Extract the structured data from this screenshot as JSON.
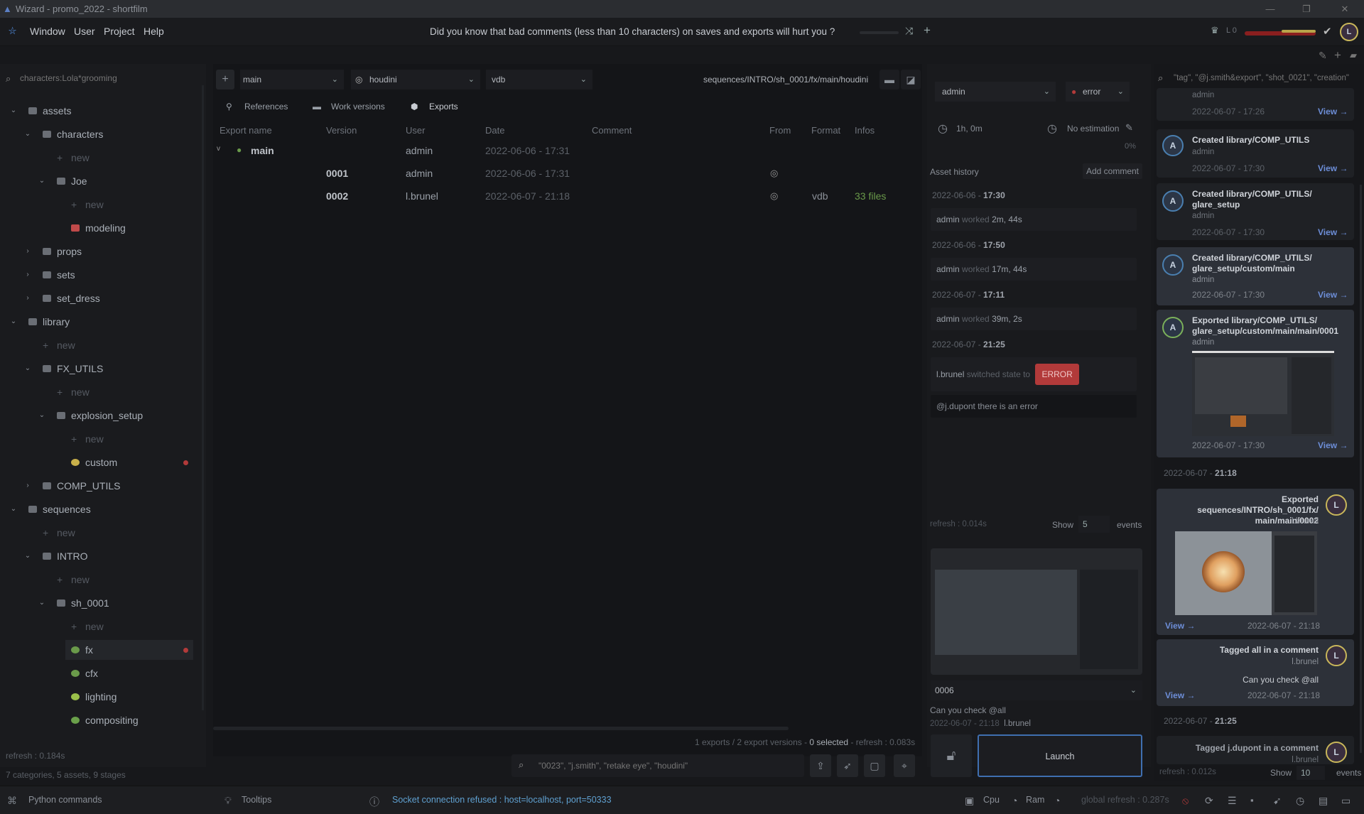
{
  "window": {
    "title": "Wizard - promo_2022 - shortfilm"
  },
  "menu": {
    "items": [
      "Window",
      "User",
      "Project",
      "Help"
    ]
  },
  "tip": "Did you know that bad comments (less than 10 characters) on saves and exports will hurt you ?",
  "header_right": {
    "level": "L 0",
    "avatar": "L"
  },
  "left": {
    "search_placeholder": "characters:Lola*grooming",
    "tree": [
      {
        "label": "assets",
        "depth": 0,
        "chev": "v"
      },
      {
        "label": "characters",
        "depth": 1,
        "chev": "v"
      },
      {
        "label": "new",
        "depth": 2,
        "new": true
      },
      {
        "label": "Joe",
        "depth": 2,
        "chev": "v"
      },
      {
        "label": "new",
        "depth": 3,
        "new": true
      },
      {
        "label": "modeling",
        "depth": 3
      },
      {
        "label": "props",
        "depth": 1,
        "chev": ">"
      },
      {
        "label": "sets",
        "depth": 1,
        "chev": ">"
      },
      {
        "label": "set_dress",
        "depth": 1,
        "chev": ">"
      },
      {
        "label": "library",
        "depth": 0,
        "chev": "v"
      },
      {
        "label": "new",
        "depth": 1,
        "new": true
      },
      {
        "label": "FX_UTILS",
        "depth": 1,
        "chev": "v"
      },
      {
        "label": "new",
        "depth": 2,
        "new": true
      },
      {
        "label": "explosion_setup",
        "depth": 2,
        "chev": "v"
      },
      {
        "label": "new",
        "depth": 3,
        "new": true
      },
      {
        "label": "custom",
        "depth": 3,
        "dot": true
      },
      {
        "label": "COMP_UTILS",
        "depth": 1,
        "chev": ">"
      },
      {
        "label": "sequences",
        "depth": 0,
        "chev": "v"
      },
      {
        "label": "new",
        "depth": 1,
        "new": true
      },
      {
        "label": "INTRO",
        "depth": 1,
        "chev": "v"
      },
      {
        "label": "new",
        "depth": 2,
        "new": true
      },
      {
        "label": "sh_0001",
        "depth": 2,
        "chev": "v"
      },
      {
        "label": "new",
        "depth": 3,
        "new": true
      },
      {
        "label": "fx",
        "depth": 3,
        "dot": true,
        "selected": true
      },
      {
        "label": "cfx",
        "depth": 3
      },
      {
        "label": "lighting",
        "depth": 3
      },
      {
        "label": "compositing",
        "depth": 3
      }
    ],
    "refresh": "refresh : 0.184s",
    "summary": "7 categories, 5 assets, 9 stages"
  },
  "center": {
    "combo_main": "main",
    "combo_software": "houdini",
    "combo_format": "vdb",
    "path": "sequences/INTRO/sh_0001/fx/main/houdini",
    "tabs": [
      "References",
      "Work versions",
      "Exports"
    ],
    "columns": [
      "Export name",
      "Version",
      "User",
      "Date",
      "Comment",
      "From",
      "Format",
      "Infos"
    ],
    "group": {
      "name": "main",
      "user": "admin",
      "date": "2022-06-06 - 17:31"
    },
    "rows": [
      {
        "version": "0001",
        "user": "admin",
        "date": "2022-06-06 - 17:31",
        "format": "",
        "infos": ""
      },
      {
        "version": "0002",
        "user": "l.brunel",
        "date": "2022-06-07 - 21:18",
        "format": "vdb",
        "infos": "33 files"
      }
    ],
    "status_prefix": "1 exports / 2 export versions - ",
    "status_selected": "0 selected",
    "status_refresh": " - refresh : 0.083s",
    "search_placeholder": "\"0023\", \"j.smith\", \"retake eye\", \"houdini\""
  },
  "right": {
    "user_combo": "admin",
    "state_combo": "error",
    "time": "1h, 0m",
    "estimation": "No estimation",
    "percent": "0%",
    "history_title": "Asset history",
    "add_comment": "Add comment",
    "history": [
      {
        "date": "2022-06-06 - ",
        "time": "17:30",
        "user": "admin",
        "verb": "worked",
        "value": "2m, 44s"
      },
      {
        "date": "2022-06-06 - ",
        "time": "17:50",
        "user": "admin",
        "verb": "worked",
        "value": "17m, 44s"
      },
      {
        "date": "2022-06-07 - ",
        "time": "17:11",
        "user": "admin",
        "verb": "worked",
        "value": "39m, 2s"
      },
      {
        "date": "2022-06-07 - ",
        "time": "21:25",
        "user": "l.brunel",
        "verb": "switched state to",
        "value": "ERROR"
      }
    ],
    "comment": "@j.dupont there is an error",
    "refresh": "refresh : 0.014s",
    "show_label": "Show",
    "show_value": "5",
    "events_label": "events",
    "version_combo": "0006",
    "version_comment": "Can you check @all",
    "version_date": "2022-06-07 - 21:18",
    "version_user": "l.brunel",
    "launch": "Launch"
  },
  "feed": {
    "search_placeholder": "\"tag\", \"@j.smith&export\", \"shot_0021\", \"creation\"",
    "top_partial": {
      "user": "admin",
      "date": "2022-06-07 - 17:26",
      "view": "View →"
    },
    "cards": [
      {
        "title": "Created library/COMP_UTILS",
        "user": "admin",
        "date": "2022-06-07 - 17:30",
        "view": "View →",
        "avatar": "A"
      },
      {
        "title": "Created library/COMP_UTILS/ glare_setup",
        "user": "admin",
        "date": "2022-06-07 - 17:30",
        "view": "View →",
        "avatar": "A"
      },
      {
        "title": "Created library/COMP_UTILS/ glare_setup/custom/main",
        "user": "admin",
        "date": "2022-06-07 - 17:30",
        "view": "View →",
        "avatar": "A"
      },
      {
        "title": "Exported library/COMP_UTILS/ glare_setup/custom/main/main/0001",
        "user": "admin",
        "date": "2022-06-07 - 17:30",
        "view": "View →",
        "avatar": "A"
      }
    ],
    "sep1": {
      "date": "2022-06-07 - ",
      "time": "21:18"
    },
    "export_card": {
      "title": "Exported sequences/INTRO/sh_0001/fx/ main/main/0002",
      "user": "l.brunel",
      "date": "2022-06-07 - 21:18",
      "view": "View →",
      "avatar": "L"
    },
    "tag_card": {
      "title": "Tagged all in a comment",
      "user": "l.brunel",
      "comment": "Can you check @all",
      "date": "2022-06-07 - 21:18",
      "view": "View →",
      "avatar": "L"
    },
    "sep2": {
      "date": "2022-06-07 - ",
      "time": "21:25"
    },
    "tag_card2": {
      "title": "Tagged j.dupont in a comment",
      "user": "l.brunel",
      "avatar": "L"
    },
    "refresh": "refresh : 0.012s",
    "show_label": "Show",
    "show_value": "10",
    "events_label": "events"
  },
  "status": {
    "python": "Python commands",
    "tooltips": "Tooltips",
    "socket": "Socket connection refused : host=localhost, port=50333",
    "cpu": "Cpu",
    "ram": "Ram",
    "global_refresh": "global refresh : 0.287s"
  },
  "colors": {
    "error": "#b23a3a",
    "link": "#6d8ed8",
    "green": "#6a9a4a",
    "accent": "#3f6fb0"
  }
}
